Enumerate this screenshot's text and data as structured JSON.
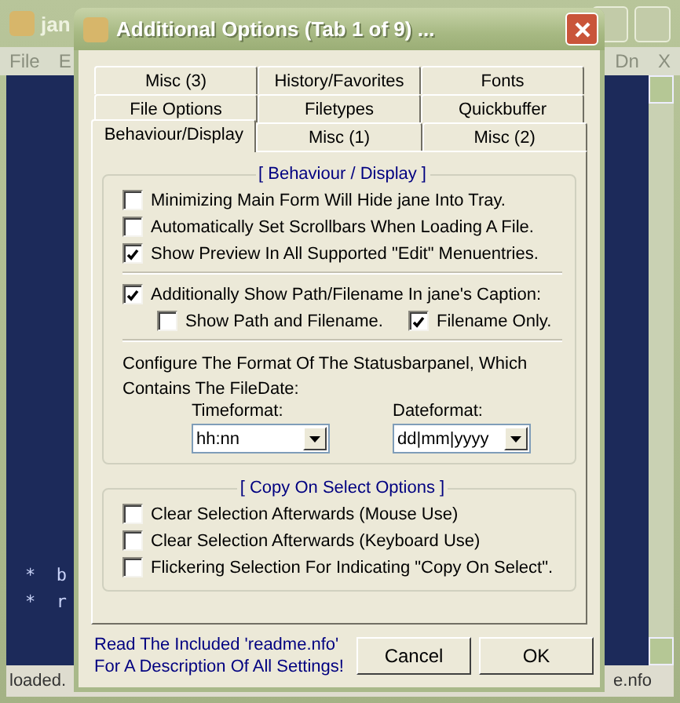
{
  "background_window": {
    "title": "jan",
    "menu_left": [
      "File",
      "E"
    ],
    "menu_right": [
      "Dn",
      "X"
    ],
    "editor_lines": [
      "*  b",
      "*  r"
    ],
    "status": [
      "loaded.",
      "e.nfo"
    ]
  },
  "dialog": {
    "title": "Additional Options (Tab 1 of 9) ...",
    "tab_rows": [
      {
        "tabs": [
          {
            "label": "Misc (3)",
            "selected": false
          },
          {
            "label": "History/Favorites",
            "selected": false
          },
          {
            "label": "Fonts",
            "selected": false
          }
        ]
      },
      {
        "tabs": [
          {
            "label": "File Options",
            "selected": false
          },
          {
            "label": "Filetypes",
            "selected": false
          },
          {
            "label": "Quickbuffer",
            "selected": false
          }
        ]
      },
      {
        "tabs": [
          {
            "label": "Behaviour/Display",
            "selected": true
          },
          {
            "label": "Misc (1)",
            "selected": false
          },
          {
            "label": "Misc (2)",
            "selected": false
          }
        ]
      }
    ],
    "behaviour_group": {
      "title": "[ Behaviour / Display ]",
      "options": [
        {
          "label": "Minimizing Main Form Will Hide jane Into Tray.",
          "checked": false
        },
        {
          "label": "Automatically Set Scrollbars When Loading A File.",
          "checked": false
        },
        {
          "label": "Show Preview In All Supported \"Edit\" Menuentries.",
          "checked": true
        }
      ],
      "caption_option": {
        "label": "Additionally Show Path/Filename In jane's Caption:",
        "checked": true,
        "children": [
          {
            "label": "Show Path and Filename.",
            "checked": false
          },
          {
            "label": "Filename Only.",
            "checked": true
          }
        ]
      },
      "statusbar_text": "Configure The Format Of The Statusbarpanel, Which Contains The FileDate:",
      "fields": [
        {
          "label": "Timeformat:",
          "value": "hh:nn"
        },
        {
          "label": "Dateformat:",
          "value": "dd|mm|yyyy"
        }
      ]
    },
    "copy_group": {
      "title": "[ Copy On Select Options ]",
      "options": [
        {
          "label": "Clear Selection Afterwards (Mouse Use)",
          "checked": false
        },
        {
          "label": "Clear Selection Afterwards (Keyboard Use)",
          "checked": false
        },
        {
          "label": "Flickering Selection For Indicating \"Copy On Select\".",
          "checked": false
        }
      ]
    },
    "hint": "Read The Included 'readme.nfo' For A Description Of All Settings!",
    "buttons": [
      "Cancel",
      "OK"
    ]
  }
}
